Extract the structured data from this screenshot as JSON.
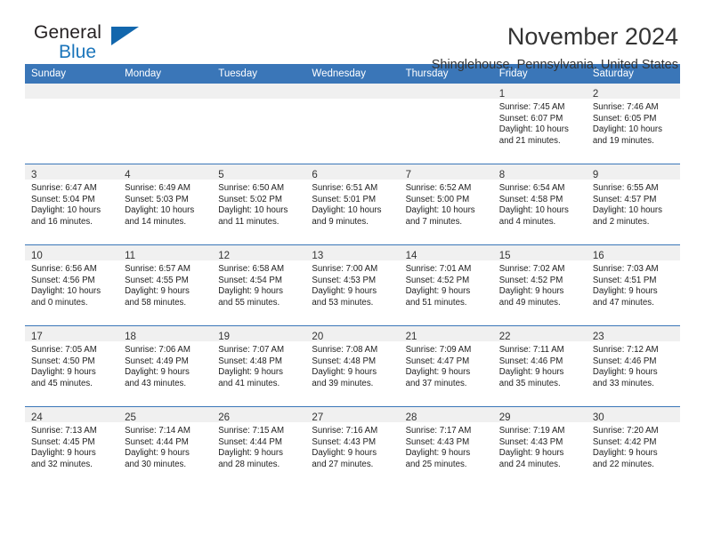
{
  "brand": {
    "name_part1": "General",
    "name_part2": "Blue",
    "triangle_color": "#1267ad",
    "blue_text_color": "#1b75bb"
  },
  "header": {
    "title": "November 2024",
    "subtitle": "Shinglehouse, Pennsylvania, United States",
    "header_bar_color": "#3a76b8"
  },
  "weekdays": [
    "Sunday",
    "Monday",
    "Tuesday",
    "Wednesday",
    "Thursday",
    "Friday",
    "Saturday"
  ],
  "weeks": [
    [
      {
        "empty": true
      },
      {
        "empty": true
      },
      {
        "empty": true
      },
      {
        "empty": true
      },
      {
        "empty": true
      },
      {
        "day": "1",
        "sunrise": "Sunrise: 7:45 AM",
        "sunset": "Sunset: 6:07 PM",
        "daylight1": "Daylight: 10 hours",
        "daylight2": "and 21 minutes."
      },
      {
        "day": "2",
        "sunrise": "Sunrise: 7:46 AM",
        "sunset": "Sunset: 6:05 PM",
        "daylight1": "Daylight: 10 hours",
        "daylight2": "and 19 minutes."
      }
    ],
    [
      {
        "day": "3",
        "sunrise": "Sunrise: 6:47 AM",
        "sunset": "Sunset: 5:04 PM",
        "daylight1": "Daylight: 10 hours",
        "daylight2": "and 16 minutes."
      },
      {
        "day": "4",
        "sunrise": "Sunrise: 6:49 AM",
        "sunset": "Sunset: 5:03 PM",
        "daylight1": "Daylight: 10 hours",
        "daylight2": "and 14 minutes."
      },
      {
        "day": "5",
        "sunrise": "Sunrise: 6:50 AM",
        "sunset": "Sunset: 5:02 PM",
        "daylight1": "Daylight: 10 hours",
        "daylight2": "and 11 minutes."
      },
      {
        "day": "6",
        "sunrise": "Sunrise: 6:51 AM",
        "sunset": "Sunset: 5:01 PM",
        "daylight1": "Daylight: 10 hours",
        "daylight2": "and 9 minutes."
      },
      {
        "day": "7",
        "sunrise": "Sunrise: 6:52 AM",
        "sunset": "Sunset: 5:00 PM",
        "daylight1": "Daylight: 10 hours",
        "daylight2": "and 7 minutes."
      },
      {
        "day": "8",
        "sunrise": "Sunrise: 6:54 AM",
        "sunset": "Sunset: 4:58 PM",
        "daylight1": "Daylight: 10 hours",
        "daylight2": "and 4 minutes."
      },
      {
        "day": "9",
        "sunrise": "Sunrise: 6:55 AM",
        "sunset": "Sunset: 4:57 PM",
        "daylight1": "Daylight: 10 hours",
        "daylight2": "and 2 minutes."
      }
    ],
    [
      {
        "day": "10",
        "sunrise": "Sunrise: 6:56 AM",
        "sunset": "Sunset: 4:56 PM",
        "daylight1": "Daylight: 10 hours",
        "daylight2": "and 0 minutes."
      },
      {
        "day": "11",
        "sunrise": "Sunrise: 6:57 AM",
        "sunset": "Sunset: 4:55 PM",
        "daylight1": "Daylight: 9 hours",
        "daylight2": "and 58 minutes."
      },
      {
        "day": "12",
        "sunrise": "Sunrise: 6:58 AM",
        "sunset": "Sunset: 4:54 PM",
        "daylight1": "Daylight: 9 hours",
        "daylight2": "and 55 minutes."
      },
      {
        "day": "13",
        "sunrise": "Sunrise: 7:00 AM",
        "sunset": "Sunset: 4:53 PM",
        "daylight1": "Daylight: 9 hours",
        "daylight2": "and 53 minutes."
      },
      {
        "day": "14",
        "sunrise": "Sunrise: 7:01 AM",
        "sunset": "Sunset: 4:52 PM",
        "daylight1": "Daylight: 9 hours",
        "daylight2": "and 51 minutes."
      },
      {
        "day": "15",
        "sunrise": "Sunrise: 7:02 AM",
        "sunset": "Sunset: 4:52 PM",
        "daylight1": "Daylight: 9 hours",
        "daylight2": "and 49 minutes."
      },
      {
        "day": "16",
        "sunrise": "Sunrise: 7:03 AM",
        "sunset": "Sunset: 4:51 PM",
        "daylight1": "Daylight: 9 hours",
        "daylight2": "and 47 minutes."
      }
    ],
    [
      {
        "day": "17",
        "sunrise": "Sunrise: 7:05 AM",
        "sunset": "Sunset: 4:50 PM",
        "daylight1": "Daylight: 9 hours",
        "daylight2": "and 45 minutes."
      },
      {
        "day": "18",
        "sunrise": "Sunrise: 7:06 AM",
        "sunset": "Sunset: 4:49 PM",
        "daylight1": "Daylight: 9 hours",
        "daylight2": "and 43 minutes."
      },
      {
        "day": "19",
        "sunrise": "Sunrise: 7:07 AM",
        "sunset": "Sunset: 4:48 PM",
        "daylight1": "Daylight: 9 hours",
        "daylight2": "and 41 minutes."
      },
      {
        "day": "20",
        "sunrise": "Sunrise: 7:08 AM",
        "sunset": "Sunset: 4:48 PM",
        "daylight1": "Daylight: 9 hours",
        "daylight2": "and 39 minutes."
      },
      {
        "day": "21",
        "sunrise": "Sunrise: 7:09 AM",
        "sunset": "Sunset: 4:47 PM",
        "daylight1": "Daylight: 9 hours",
        "daylight2": "and 37 minutes."
      },
      {
        "day": "22",
        "sunrise": "Sunrise: 7:11 AM",
        "sunset": "Sunset: 4:46 PM",
        "daylight1": "Daylight: 9 hours",
        "daylight2": "and 35 minutes."
      },
      {
        "day": "23",
        "sunrise": "Sunrise: 7:12 AM",
        "sunset": "Sunset: 4:46 PM",
        "daylight1": "Daylight: 9 hours",
        "daylight2": "and 33 minutes."
      }
    ],
    [
      {
        "day": "24",
        "sunrise": "Sunrise: 7:13 AM",
        "sunset": "Sunset: 4:45 PM",
        "daylight1": "Daylight: 9 hours",
        "daylight2": "and 32 minutes."
      },
      {
        "day": "25",
        "sunrise": "Sunrise: 7:14 AM",
        "sunset": "Sunset: 4:44 PM",
        "daylight1": "Daylight: 9 hours",
        "daylight2": "and 30 minutes."
      },
      {
        "day": "26",
        "sunrise": "Sunrise: 7:15 AM",
        "sunset": "Sunset: 4:44 PM",
        "daylight1": "Daylight: 9 hours",
        "daylight2": "and 28 minutes."
      },
      {
        "day": "27",
        "sunrise": "Sunrise: 7:16 AM",
        "sunset": "Sunset: 4:43 PM",
        "daylight1": "Daylight: 9 hours",
        "daylight2": "and 27 minutes."
      },
      {
        "day": "28",
        "sunrise": "Sunrise: 7:17 AM",
        "sunset": "Sunset: 4:43 PM",
        "daylight1": "Daylight: 9 hours",
        "daylight2": "and 25 minutes."
      },
      {
        "day": "29",
        "sunrise": "Sunrise: 7:19 AM",
        "sunset": "Sunset: 4:43 PM",
        "daylight1": "Daylight: 9 hours",
        "daylight2": "and 24 minutes."
      },
      {
        "day": "30",
        "sunrise": "Sunrise: 7:20 AM",
        "sunset": "Sunset: 4:42 PM",
        "daylight1": "Daylight: 9 hours",
        "daylight2": "and 22 minutes."
      }
    ]
  ]
}
